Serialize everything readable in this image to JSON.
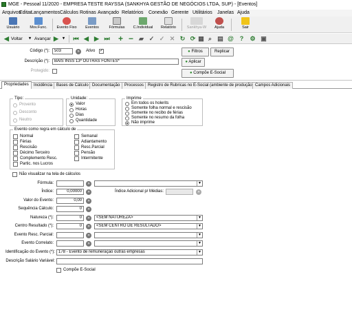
{
  "window": {
    "title": "MGE - Pessoal 11/2020 - EMPRESA TESTE RAYSSA (SANKHYA GESTÃO DE NEGÓCIOS LTDA, SUP) - [Eventos]"
  },
  "menu": [
    "Arquivos",
    "Editar",
    "Lançamentos",
    "Cálculos",
    "Rotinas",
    "Avançado",
    "Relatórios",
    "Conexão",
    "Gerente",
    "Utilitários",
    "Janelas",
    "Ajuda"
  ],
  "toolbar": {
    "buttons": [
      "Usuário",
      "Mov.Func.",
      "Evento Fixo",
      "Eventos",
      "Fórmulas",
      "C.Individual",
      "Relatório",
      "Sankhya-W",
      "Ajuda",
      "Sair"
    ],
    "nav_back": "Voltar",
    "nav_forward": "Avançar"
  },
  "header": {
    "codigo_label": "Código (*):",
    "codigo_value": "503",
    "ativo_label": "Ativo",
    "ativo_checked": true,
    "descricao_label": "Descrição (*):",
    "descricao_value": "BAIS INSS 13º OUTRAS FONTES*",
    "protegido_label": "Protegido:",
    "filtros_label": "Filtros",
    "replicar_label": "Replicar",
    "aplicar_label": "Aplicar",
    "compoe_label": "Compõe E-Social"
  },
  "tabs": [
    "Propriedades",
    "Incidência",
    "Bases de Cálculo",
    "Documentação",
    "Processos",
    "Registro de Rubricas no E-Social (ambiente de produção)",
    "Campos Adicionais"
  ],
  "tipo": {
    "title": "Tipo:",
    "options": [
      "Provento",
      "Desconto",
      "Neutro"
    ],
    "selected": null
  },
  "unidade": {
    "title": "Unidade:",
    "options": [
      "Valor",
      "Horas",
      "Dias",
      "Quantidade"
    ],
    "selected": 0
  },
  "imprime": {
    "title": "Imprime",
    "options": [
      "Em todos os holerits",
      "Somente folha normal e rescisão",
      "Somente no recibo de férias",
      "Somente no resumo da folha",
      "Não imprime"
    ],
    "selected": 4
  },
  "regra": {
    "title": "Evento como regra em cálculo de",
    "left": [
      "Normal",
      "Férias",
      "Rescisão",
      "Décimo Terceiro",
      "Complemento Resc.",
      "Partic. nos Lucros"
    ],
    "right": [
      "Semanal",
      "Adiantamento",
      "Resc.Parcial",
      "Pensão",
      "Intermitente"
    ]
  },
  "nao_visualizar_label": "Não visualizar na tela de cálculos",
  "fields": {
    "formula_label": "Fórmula:",
    "indice_label": "Índice:",
    "indice_value": "0,00000",
    "indice_adicional_label": "Índice Adicional p/ Médias:",
    "valor_label": "Valor do Evento:",
    "valor_value": "0,00",
    "sequencia_label": "Sequência Cálculo:",
    "sequencia_value": "0",
    "natureza_label": "Natureza (*):",
    "natureza_code": "0",
    "natureza_value": "<SEM NATUREZA>",
    "centro_label": "Centro Resultado (*):",
    "centro_code": "0",
    "centro_value": "<SEM CENTRO DE RESULTADO>",
    "evento_resc_label": "Evento Resc. Parcial:",
    "evento_correlato_label": "Evento Correlato:",
    "identificacao_label": "Identificação do Evento (*):",
    "identificacao_value": "178 - Evento de remuneração outras empresas",
    "descricao_salario_label": "Descrição Salário Variável:",
    "compoe_esocial_label": "Compõe E-Social"
  },
  "colors": {
    "accent_green": "#2e8b2e",
    "toolbar_bg": "#f0f0f0"
  }
}
